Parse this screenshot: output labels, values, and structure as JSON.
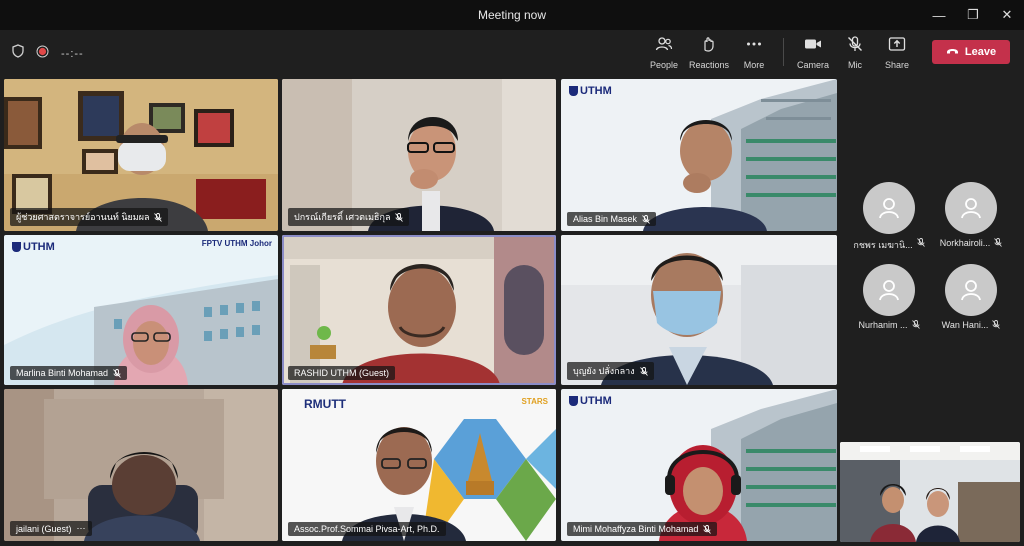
{
  "window": {
    "title": "Meeting now",
    "minimize": "—",
    "restore": "❐",
    "close": "✕"
  },
  "toolbar": {
    "timer": "--:--",
    "buttons": [
      {
        "label": "People",
        "icon": "people-icon"
      },
      {
        "label": "Reactions",
        "icon": "reactions-icon"
      },
      {
        "label": "More",
        "icon": "more-icon"
      },
      {
        "label": "Camera",
        "icon": "camera-icon"
      },
      {
        "label": "Mic",
        "icon": "mic-muted-icon"
      },
      {
        "label": "Share",
        "icon": "share-icon"
      }
    ],
    "leave": "Leave"
  },
  "participants": [
    {
      "name": "ผู้ช่วยศาสตราจารย์อานนท์ นิยมผล"
    },
    {
      "name": "ปกรณ์เกียรติ์ เศวตเมธิกุล"
    },
    {
      "name": "Alias Bin Masek"
    },
    {
      "name": "Marlina Binti Mohamad"
    },
    {
      "name": "RASHID UTHM (Guest)"
    },
    {
      "name": "บุญยัง ปลั่งกลาง"
    },
    {
      "name": "jailani (Guest)",
      "more": "⋯"
    },
    {
      "name": "Assoc.Prof.Sommai Pivsa-Art, Ph.D."
    },
    {
      "name": "Mimi Mohaffyza Binti Mohamad"
    }
  ],
  "audio_only": [
    {
      "name": "กชพร เมฆานิ..."
    },
    {
      "name": "Norkhairoli..."
    },
    {
      "name": "Nurhanim ..."
    },
    {
      "name": "Wan Hani..."
    }
  ],
  "logos": {
    "uthm": "UTHM",
    "fptv": "FPTV UTHM Johor",
    "rmutt": "RMUTT",
    "stars": "STARS"
  },
  "colors": {
    "leave": "#c4314b",
    "active_outline": "#8b8cc7",
    "record": "#e04848"
  }
}
